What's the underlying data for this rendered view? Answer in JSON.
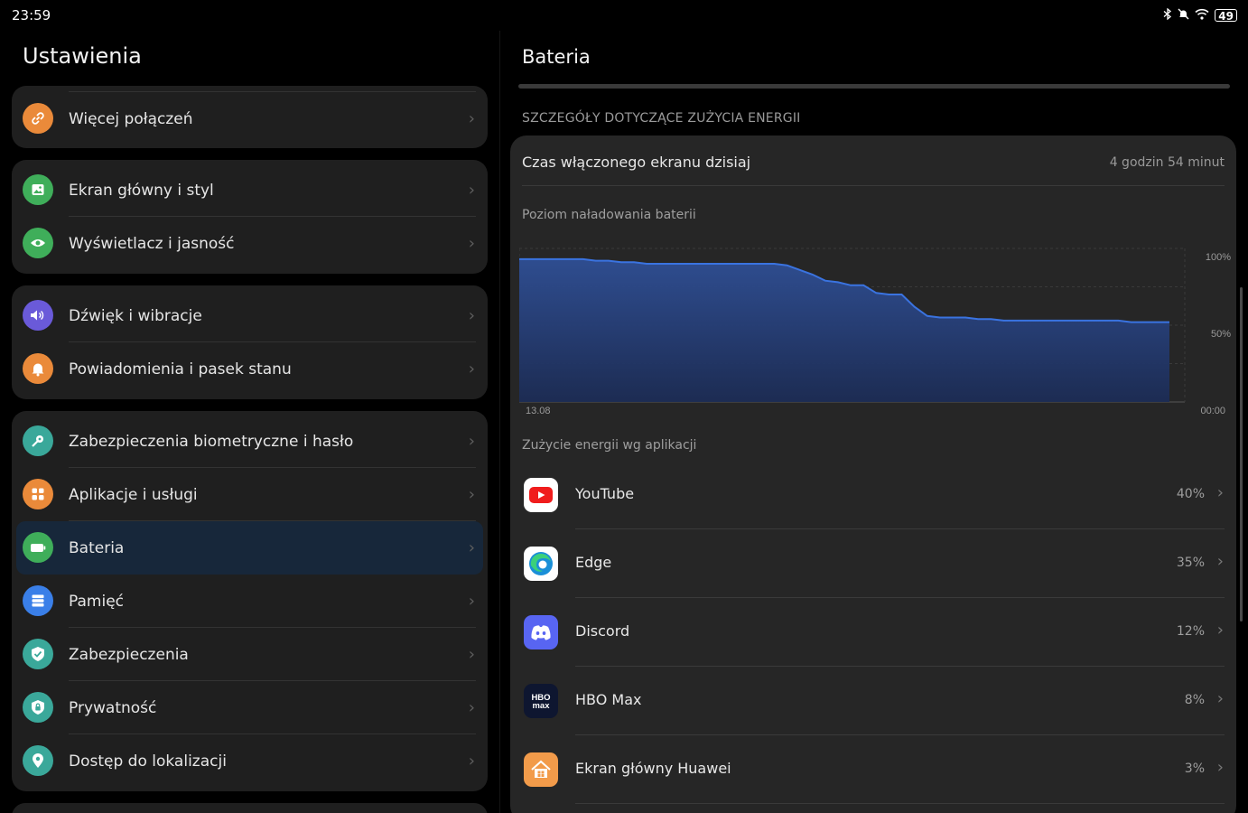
{
  "status": {
    "time": "23:59",
    "battery": "49"
  },
  "left": {
    "title": "Ustawienia",
    "groups": [
      {
        "items": [
          {
            "label": "Więcej połączeń",
            "icon": "link-icon",
            "color": "#ea8a3a"
          }
        ]
      },
      {
        "items": [
          {
            "label": "Ekran główny i styl",
            "icon": "image-icon",
            "color": "#3fae5a"
          },
          {
            "label": "Wyświetlacz i jasność",
            "icon": "eye-icon",
            "color": "#3fae5a"
          }
        ]
      },
      {
        "items": [
          {
            "label": "Dźwięk i wibracje",
            "icon": "speaker-icon",
            "color": "#6a5ad9"
          },
          {
            "label": "Powiadomienia i pasek stanu",
            "icon": "bell-icon",
            "color": "#ea8a3a"
          }
        ]
      },
      {
        "items": [
          {
            "label": "Zabezpieczenia biometryczne i hasło",
            "icon": "key-icon",
            "color": "#3aa89a"
          },
          {
            "label": "Aplikacje i usługi",
            "icon": "apps-grid-icon",
            "color": "#ea8a3a"
          },
          {
            "label": "Bateria",
            "icon": "battery-icon",
            "color": "#3fae5a"
          },
          {
            "label": "Pamięć",
            "icon": "storage-icon",
            "color": "#3a7fe8"
          },
          {
            "label": "Zabezpieczenia",
            "icon": "shield-check-icon",
            "color": "#3aa89a"
          },
          {
            "label": "Prywatność",
            "icon": "shield-lock-icon",
            "color": "#3aa89a"
          },
          {
            "label": "Dostęp do lokalizacji",
            "icon": "location-pin-icon",
            "color": "#3aa89a"
          }
        ]
      }
    ]
  },
  "right": {
    "title": "Bateria",
    "section_header": "SZCZEGÓŁY DOTYCZĄCE ZUŻYCIA ENERGII",
    "screen_time_label": "Czas włączonego ekranu dzisiaj",
    "screen_time_value": "4 godzin 54 minut",
    "chart_title": "Poziom naładowania baterii",
    "usage_title": "Zużycie energii wg aplikacji",
    "apps": [
      {
        "name": "YouTube",
        "percent": "40%",
        "icon": "youtube-icon"
      },
      {
        "name": "Edge",
        "percent": "35%",
        "icon": "edge-icon"
      },
      {
        "name": "Discord",
        "percent": "12%",
        "icon": "discord-icon"
      },
      {
        "name": "HBO Max",
        "percent": "8%",
        "icon": "hbomax-icon"
      },
      {
        "name": "Ekran główny Huawei",
        "percent": "3%",
        "icon": "huawei-home-icon"
      }
    ]
  },
  "chart_data": {
    "type": "area",
    "title": "Poziom naładowania baterii",
    "x_labels": [
      "13.08",
      "00:00"
    ],
    "y_labels": [
      "100%",
      "50%"
    ],
    "ylim": [
      0,
      100
    ],
    "series": [
      {
        "values": [
          93,
          93,
          93,
          93,
          93,
          93,
          92,
          92,
          91,
          91,
          90,
          90,
          90,
          90,
          90,
          90,
          90,
          90,
          90,
          90,
          90,
          89,
          86,
          83,
          79,
          78,
          76,
          76,
          71,
          70,
          70,
          62,
          56,
          55,
          55,
          55,
          54,
          54,
          53,
          53,
          53,
          53,
          53,
          53,
          53,
          53,
          53,
          53,
          52,
          52,
          52,
          52
        ]
      }
    ],
    "grid": true,
    "line_color": "#3a73e0"
  }
}
